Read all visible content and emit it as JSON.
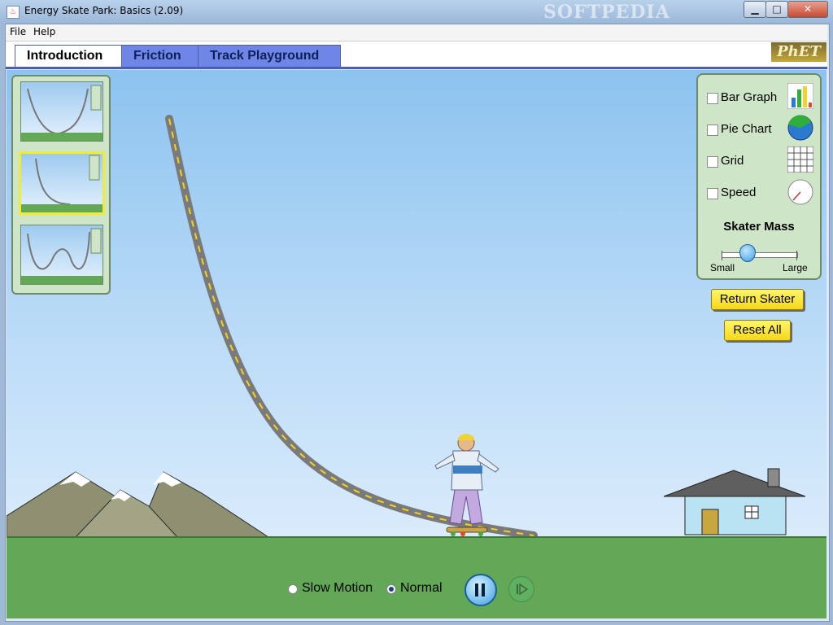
{
  "window": {
    "title": "Energy Skate Park: Basics (2.09)",
    "watermark": "SOFTPEDIA",
    "minimize": "▁",
    "maximize": "□",
    "close": "✕"
  },
  "menu": {
    "items": [
      "File",
      "Help"
    ]
  },
  "tabs": [
    {
      "label": "Introduction",
      "active": true
    },
    {
      "label": "Friction",
      "active": false
    },
    {
      "label": "Track Playground",
      "active": false
    }
  ],
  "logo": {
    "text": "PhET"
  },
  "thumbnails": [
    {
      "name": "track-u-shape",
      "selected": false
    },
    {
      "name": "track-ramp",
      "selected": true
    },
    {
      "name": "track-w-shape",
      "selected": false
    }
  ],
  "controls": {
    "bar_graph": {
      "label": "Bar Graph",
      "checked": false,
      "icon": "bar-graph-icon"
    },
    "pie_chart": {
      "label": "Pie Chart",
      "checked": false,
      "icon": "pie-chart-icon"
    },
    "grid": {
      "label": "Grid",
      "checked": false,
      "icon": "grid-icon"
    },
    "speed": {
      "label": "Speed",
      "checked": false,
      "icon": "speedometer-icon"
    },
    "skater_mass": {
      "title": "Skater Mass",
      "min_label": "Small",
      "max_label": "Large",
      "value_fraction": 0.35
    }
  },
  "buttons": {
    "return_skater": "Return Skater",
    "reset_all": "Reset All"
  },
  "playback": {
    "slow_motion": "Slow Motion",
    "normal": "Normal",
    "selected": "normal",
    "state": "playing"
  },
  "colors": {
    "sky_top": "#8cc3ef",
    "ground": "#62a856",
    "track": "#7a7a7a",
    "track_dash": "#f2d21a",
    "panel": "#cfe5c7",
    "button": "#f5d81a",
    "tab": "#6f86e6"
  }
}
